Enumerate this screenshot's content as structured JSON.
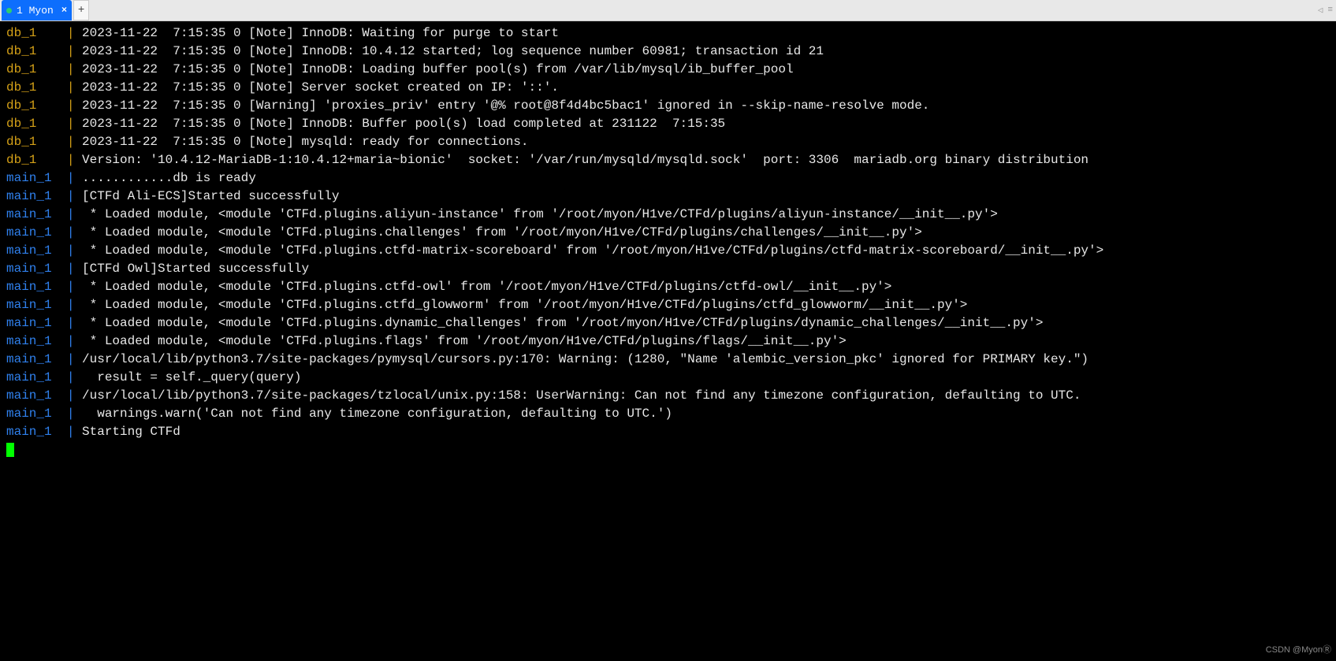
{
  "tabbar": {
    "tab_label": "1 Myon",
    "add_label": "+",
    "nav_left": "◁",
    "nav_menu": "≡"
  },
  "watermark": "CSDN @MyonⓇ",
  "lines": [
    {
      "src": "db_1",
      "pipe": "|",
      "text": "2023-11-22  7:15:35 0 [Note] InnoDB: Waiting for purge to start"
    },
    {
      "src": "db_1",
      "pipe": "|",
      "text": "2023-11-22  7:15:35 0 [Note] InnoDB: 10.4.12 started; log sequence number 60981; transaction id 21"
    },
    {
      "src": "db_1",
      "pipe": "|",
      "text": "2023-11-22  7:15:35 0 [Note] InnoDB: Loading buffer pool(s) from /var/lib/mysql/ib_buffer_pool"
    },
    {
      "src": "db_1",
      "pipe": "|",
      "text": "2023-11-22  7:15:35 0 [Note] Server socket created on IP: '::'."
    },
    {
      "src": "db_1",
      "pipe": "|",
      "text": "2023-11-22  7:15:35 0 [Warning] 'proxies_priv' entry '@% root@8f4d4bc5bac1' ignored in --skip-name-resolve mode."
    },
    {
      "src": "db_1",
      "pipe": "|",
      "text": "2023-11-22  7:15:35 0 [Note] InnoDB: Buffer pool(s) load completed at 231122  7:15:35"
    },
    {
      "src": "db_1",
      "pipe": "|",
      "text": "2023-11-22  7:15:35 0 [Note] mysqld: ready for connections."
    },
    {
      "src": "db_1",
      "pipe": "|",
      "text": "Version: '10.4.12-MariaDB-1:10.4.12+maria~bionic'  socket: '/var/run/mysqld/mysqld.sock'  port: 3306  mariadb.org binary distribution"
    },
    {
      "src": "main_1",
      "pipe": "|",
      "text": "............db is ready"
    },
    {
      "src": "main_1",
      "pipe": "|",
      "text": "[CTFd Ali-ECS]Started successfully"
    },
    {
      "src": "main_1",
      "pipe": "|",
      "text": " * Loaded module, <module 'CTFd.plugins.aliyun-instance' from '/root/myon/H1ve/CTFd/plugins/aliyun-instance/__init__.py'>"
    },
    {
      "src": "main_1",
      "pipe": "|",
      "text": " * Loaded module, <module 'CTFd.plugins.challenges' from '/root/myon/H1ve/CTFd/plugins/challenges/__init__.py'>"
    },
    {
      "src": "main_1",
      "pipe": "|",
      "text": " * Loaded module, <module 'CTFd.plugins.ctfd-matrix-scoreboard' from '/root/myon/H1ve/CTFd/plugins/ctfd-matrix-scoreboard/__init__.py'>"
    },
    {
      "src": "main_1",
      "pipe": "|",
      "text": "[CTFd Owl]Started successfully"
    },
    {
      "src": "main_1",
      "pipe": "|",
      "text": " * Loaded module, <module 'CTFd.plugins.ctfd-owl' from '/root/myon/H1ve/CTFd/plugins/ctfd-owl/__init__.py'>"
    },
    {
      "src": "main_1",
      "pipe": "|",
      "text": " * Loaded module, <module 'CTFd.plugins.ctfd_glowworm' from '/root/myon/H1ve/CTFd/plugins/ctfd_glowworm/__init__.py'>"
    },
    {
      "src": "main_1",
      "pipe": "|",
      "text": " * Loaded module, <module 'CTFd.plugins.dynamic_challenges' from '/root/myon/H1ve/CTFd/plugins/dynamic_challenges/__init__.py'>"
    },
    {
      "src": "main_1",
      "pipe": "|",
      "text": " * Loaded module, <module 'CTFd.plugins.flags' from '/root/myon/H1ve/CTFd/plugins/flags/__init__.py'>"
    },
    {
      "src": "main_1",
      "pipe": "|",
      "text": "/usr/local/lib/python3.7/site-packages/pymysql/cursors.py:170: Warning: (1280, \"Name 'alembic_version_pkc' ignored for PRIMARY key.\")"
    },
    {
      "src": "main_1",
      "pipe": "|",
      "text": "  result = self._query(query)"
    },
    {
      "src": "main_1",
      "pipe": "|",
      "text": "/usr/local/lib/python3.7/site-packages/tzlocal/unix.py:158: UserWarning: Can not find any timezone configuration, defaulting to UTC."
    },
    {
      "src": "main_1",
      "pipe": "|",
      "text": "  warnings.warn('Can not find any timezone configuration, defaulting to UTC.')"
    },
    {
      "src": "main_1",
      "pipe": "|",
      "text": "Starting CTFd"
    }
  ]
}
